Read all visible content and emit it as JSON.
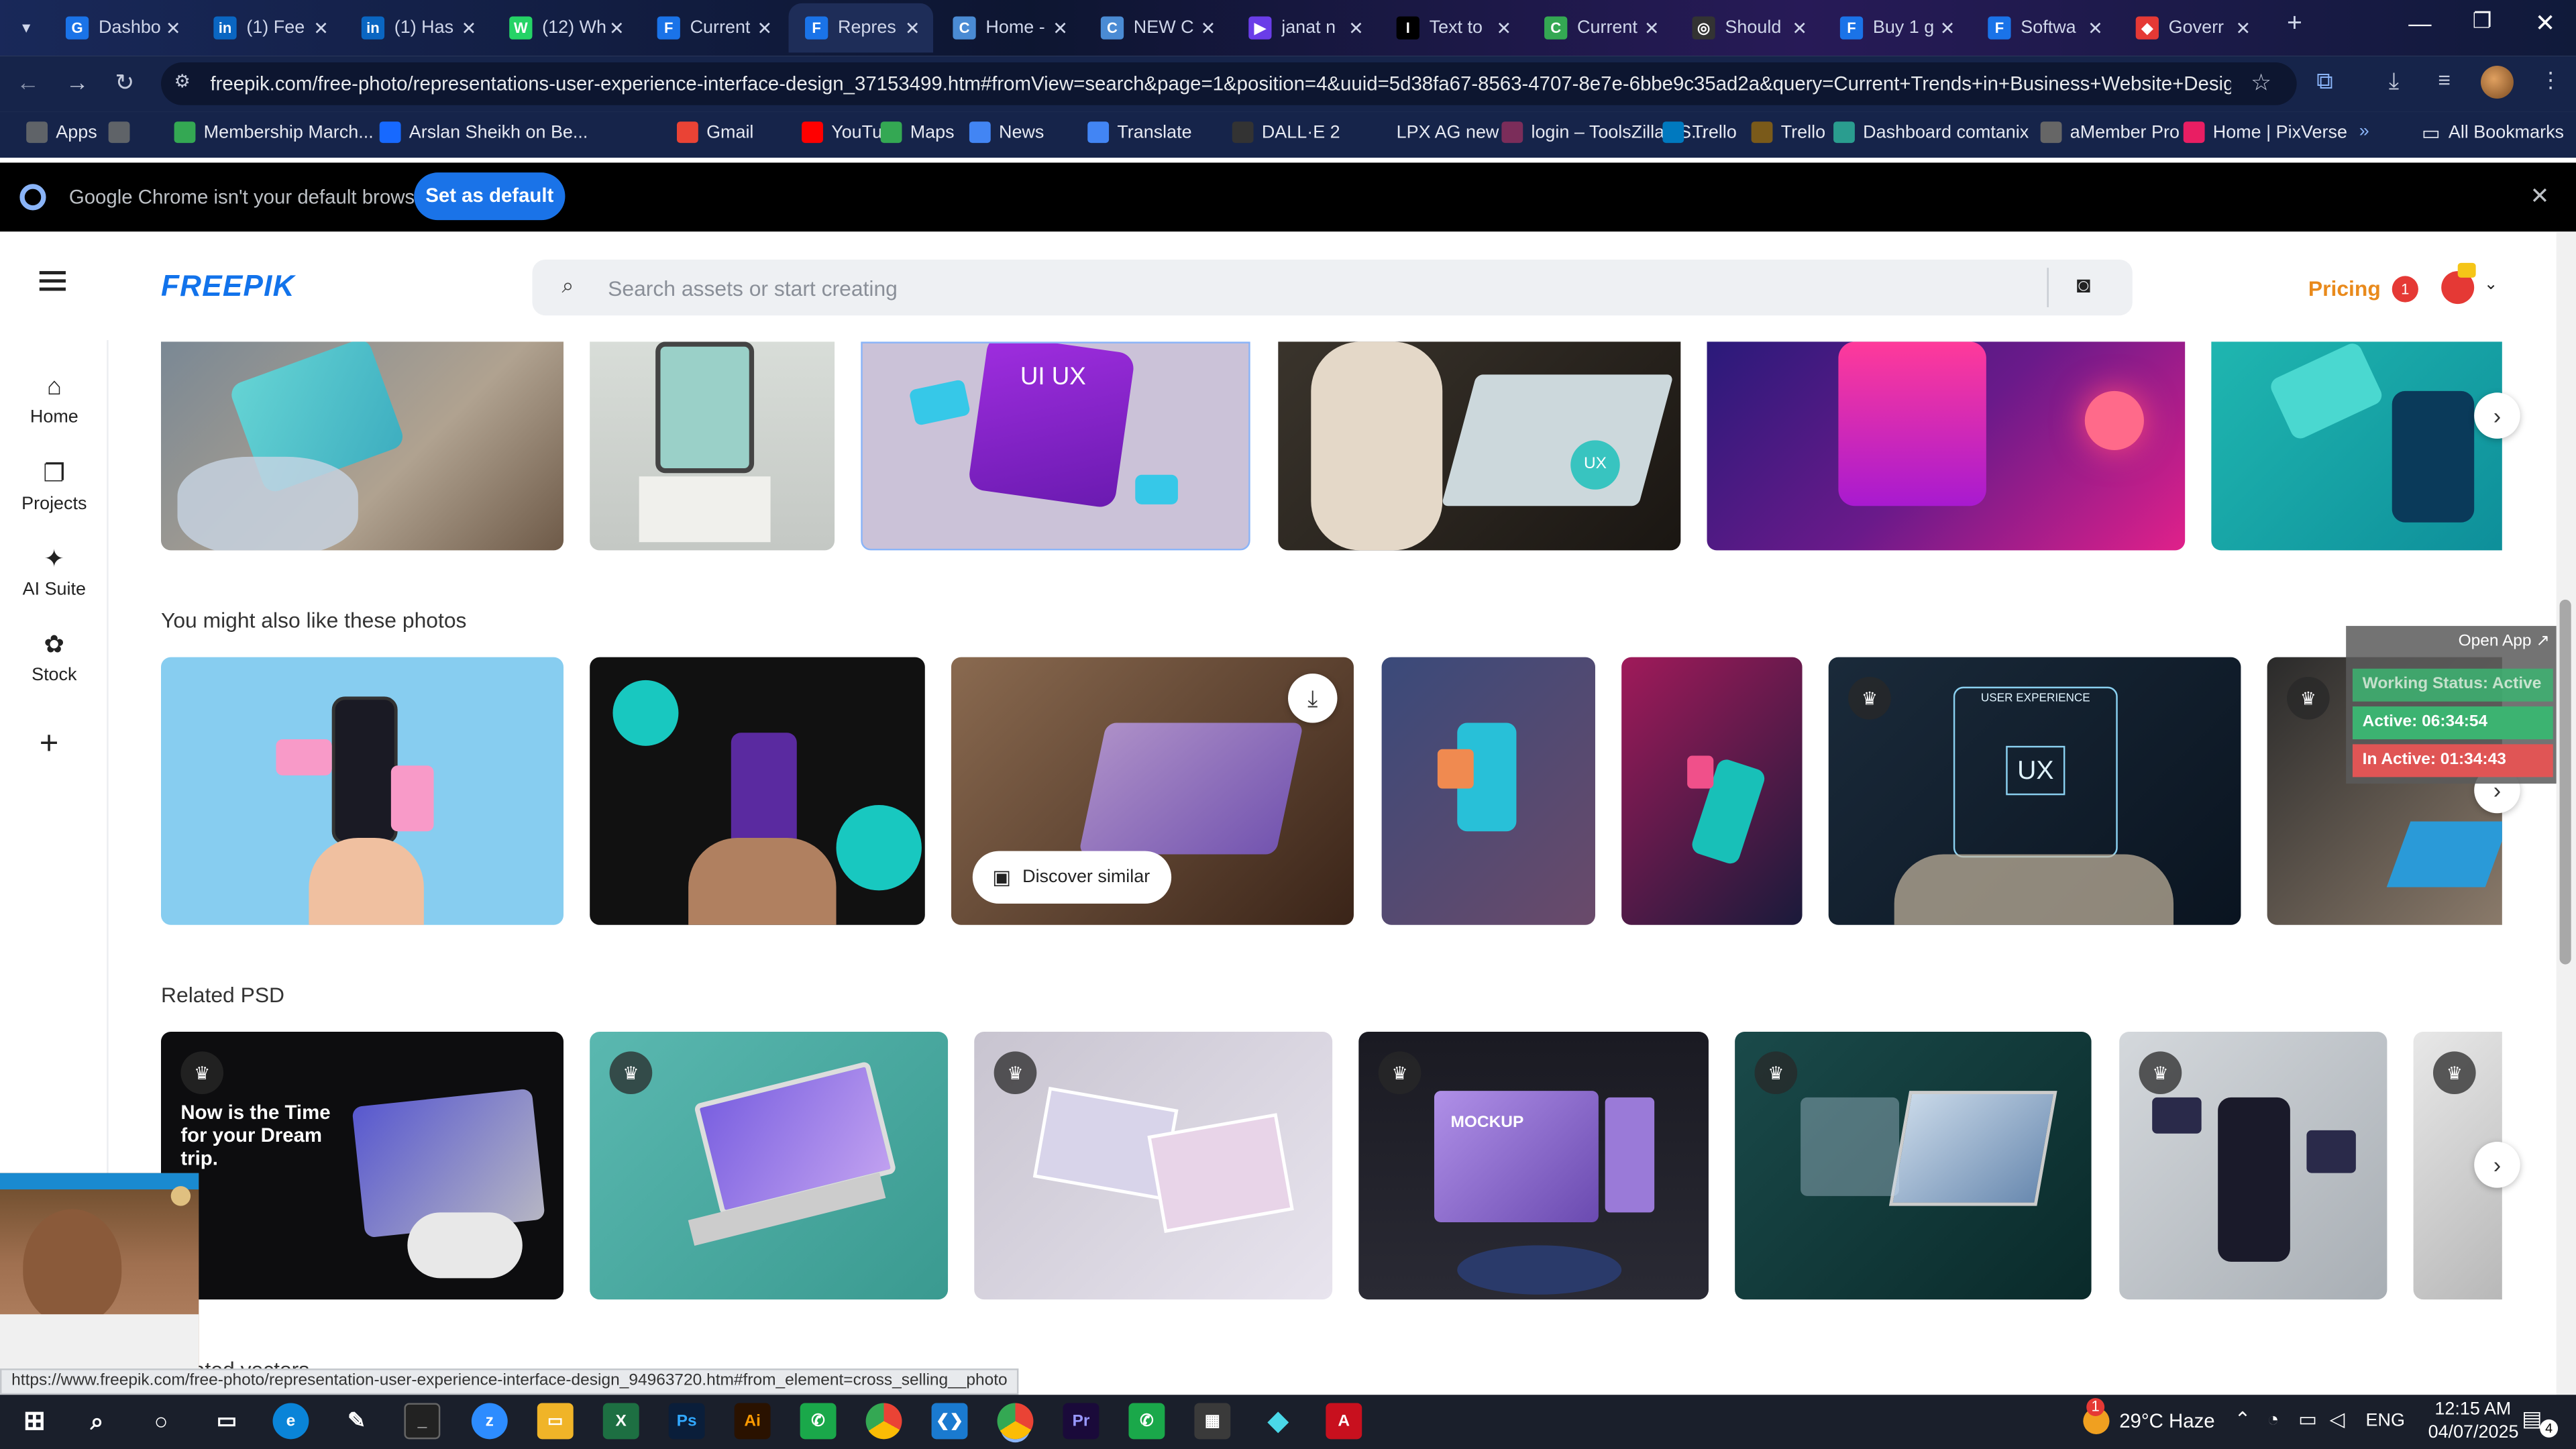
{
  "tabs": [
    {
      "label": "Dashbo",
      "color": "#1a73e8",
      "glyph": "G"
    },
    {
      "label": "(1) Fee",
      "color": "#0a66c2",
      "glyph": "in"
    },
    {
      "label": "(1) Has",
      "color": "#0a66c2",
      "glyph": "in"
    },
    {
      "label": "(12) Wh",
      "color": "#25d366",
      "glyph": "W"
    },
    {
      "label": "Current",
      "color": "#1a73e8",
      "glyph": "F"
    },
    {
      "label": "Repres",
      "color": "#1a73e8",
      "glyph": "F"
    },
    {
      "label": "Home -",
      "color": "#4a8bd4",
      "glyph": "C"
    },
    {
      "label": "NEW C",
      "color": "#4a8bd4",
      "glyph": "C"
    },
    {
      "label": "janat n",
      "color": "#6a3de8",
      "glyph": "▶"
    },
    {
      "label": "Text to",
      "color": "#000000",
      "glyph": "I"
    },
    {
      "label": "Current",
      "color": "#34a853",
      "glyph": "C"
    },
    {
      "label": "Should",
      "color": "#333333",
      "glyph": "◎"
    },
    {
      "label": "Buy 1 g",
      "color": "#1a73e8",
      "glyph": "F"
    },
    {
      "label": "Softwa",
      "color": "#1a73e8",
      "glyph": "F"
    },
    {
      "label": "Goverr",
      "color": "#e53935",
      "glyph": "◆"
    }
  ],
  "address": {
    "url": "freepik.com/free-photo/representations-user-experience-interface-design_37153499.htm#fromView=search&page=1&position=4&uuid=5d38fa67-8563-4707-8e7e-6bbe9c35ad2a&query=Current+Trends+in+Business+Website+Design+and..."
  },
  "bookmarks": [
    {
      "label": "Apps",
      "color": "#5f6368"
    },
    {
      "label": "",
      "color": "#5f6368"
    },
    {
      "label": "Membership March...",
      "color": "#34a853"
    },
    {
      "label": "Arslan Sheikh on Be...",
      "color": "#1769ff"
    },
    {
      "label": "Gmail",
      "color": "#ea4335"
    },
    {
      "label": "YouTube",
      "color": "#ff0000"
    },
    {
      "label": "Maps",
      "color": "#34a853"
    },
    {
      "label": "News",
      "color": "#4285f4"
    },
    {
      "label": "Translate",
      "color": "#4285f4"
    },
    {
      "label": "DALL·E 2",
      "color": "#333333"
    },
    {
      "label": "LPX AG new",
      "color": "#16244a"
    },
    {
      "label": "login – ToolsZilla | S...",
      "color": "#7b2d5a"
    },
    {
      "label": "Trello",
      "color": "#0079bf"
    },
    {
      "label": "Trello",
      "color": "#7a5a1a"
    },
    {
      "label": "Dashboard comtanix",
      "color": "#2a9d8f"
    },
    {
      "label": "aMember Pro",
      "color": "#666666"
    },
    {
      "label": "Home | PixVerse",
      "color": "#e91e63"
    }
  ],
  "all_bookmarks": "All Bookmarks",
  "infobar": {
    "message": "Google Chrome isn't your default browser",
    "button": "Set as default"
  },
  "freepik": {
    "logo": "FREEPIK",
    "search_placeholder": "Search assets or start creating",
    "pricing": "Pricing",
    "notification_count": "1"
  },
  "sidebar": [
    {
      "label": "Home",
      "icon": "home-icon"
    },
    {
      "label": "Projects",
      "icon": "projects-icon"
    },
    {
      "label": "AI Suite",
      "icon": "ai-suite-icon"
    },
    {
      "label": "Stock",
      "icon": "stock-icon"
    }
  ],
  "sections": {
    "also_like": "You might also like these photos",
    "related_psd": "Related PSD",
    "next_partial": "Related vectors"
  },
  "discover_similar": "Discover similar",
  "tracker": {
    "open_app": "Open App ↗",
    "working": "Working Status: Active",
    "active": "Active: 06:34:54",
    "inactive": "In Active: 01:34:43"
  },
  "psd_card": {
    "headline": "Now is the Time for your Dream trip."
  },
  "mockup_text": {
    "ui_ux": "UI UX",
    "user_experience": "USER EXPERIENCE",
    "ux": "UX",
    "mockup": "MOCKUP"
  },
  "status_url": "https://www.freepik.com/free-photo/representation-user-experience-interface-design_94963720.htm#from_element=cross_selling__photo",
  "taskbar": {
    "weather": "29°C  Haze",
    "lang": "ENG",
    "time": "12:15 AM",
    "date": "04/07/2025",
    "notif_count": "1",
    "action_count": "4"
  },
  "colors": {
    "tab_bg": "#0e1a3c",
    "toolbar_bg": "#16244a",
    "freepik_blue": "#1273eb",
    "pricing_orange": "#e98a1c",
    "tracker_green": "#3cb371",
    "tracker_red": "#e05555"
  }
}
